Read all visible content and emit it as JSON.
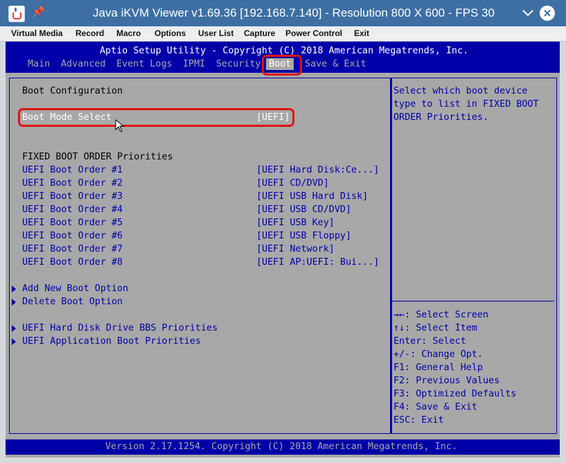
{
  "window": {
    "title": "Java iKVM Viewer v1.69.36 [192.168.7.140] - Resolution 800 X 600 - FPS 30",
    "icons": [
      "java-app-icon",
      "pin-icon",
      "minimize-icon",
      "close-icon"
    ]
  },
  "menubar": {
    "items": [
      "Virtual Media",
      "Record",
      "Macro",
      "Options",
      "User List",
      "Capture",
      "Power Control",
      "Exit"
    ]
  },
  "bios": {
    "title": "Aptio Setup Utility - Copyright (C) 2018 American Megatrends, Inc.",
    "tabs": [
      "Main",
      "Advanced",
      "Event Logs",
      "IPMI",
      "Security",
      "Boot",
      "Save & Exit"
    ],
    "active_tab": "Boot",
    "section_heading": "Boot Configuration",
    "boot_mode": {
      "label": "Boot Mode Select",
      "value": "[UEFI]"
    },
    "fixed_heading": "FIXED BOOT ORDER Priorities",
    "boot_orders": [
      {
        "label": "UEFI Boot Order #1",
        "value": "[UEFI Hard Disk:Ce...]"
      },
      {
        "label": "UEFI Boot Order #2",
        "value": "[UEFI CD/DVD]"
      },
      {
        "label": "UEFI Boot Order #3",
        "value": "[UEFI USB Hard Disk]"
      },
      {
        "label": "UEFI Boot Order #4",
        "value": "[UEFI USB CD/DVD]"
      },
      {
        "label": "UEFI Boot Order #5",
        "value": "[UEFI USB Key]"
      },
      {
        "label": "UEFI Boot Order #6",
        "value": "[UEFI USB Floppy]"
      },
      {
        "label": "UEFI Boot Order #7",
        "value": "[UEFI Network]"
      },
      {
        "label": "UEFI Boot Order #8",
        "value": "[UEFI AP:UEFI: Bui...]"
      }
    ],
    "submenus": [
      "Add New Boot Option",
      "Delete Boot Option",
      "UEFI Hard Disk Drive BBS Priorities",
      "UEFI Application Boot Priorities"
    ],
    "help_text": [
      "Select which boot device",
      "type to list in FIXED BOOT",
      "ORDER Priorities."
    ],
    "key_help": [
      "→←: Select Screen",
      "↑↓: Select Item",
      "Enter: Select",
      "+/-: Change Opt.",
      "F1: General Help",
      "F2: Previous Values",
      "F3: Optimized Defaults",
      "F4: Save & Exit",
      "ESC: Exit"
    ],
    "footer": "Version 2.17.1254. Copyright (C) 2018 American Megatrends, Inc."
  },
  "colors": {
    "bios_blue": "#0000a8",
    "bios_gray": "#a8a8a8",
    "titlebar": "#3d6fa3",
    "highlight_red": "#e01010"
  }
}
